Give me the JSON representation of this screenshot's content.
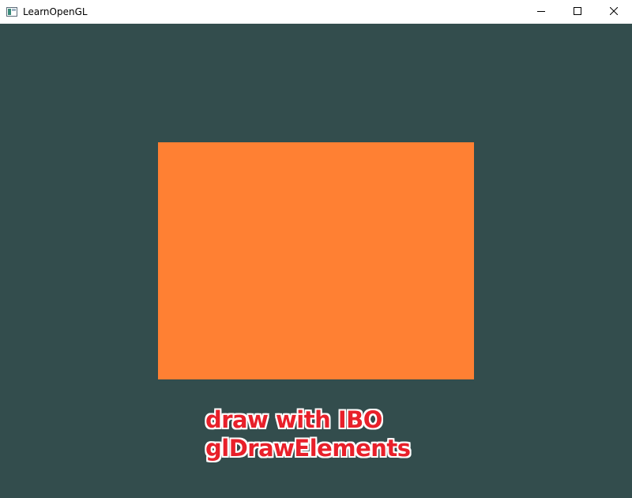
{
  "window": {
    "title": "LearnOpenGL",
    "icon": "app-window-icon",
    "controls": [
      "minimize-icon",
      "maximize-icon",
      "close-icon"
    ]
  },
  "scene": {
    "clear_color": "#334d4d",
    "quad_color": "#ff8033"
  },
  "annotation": {
    "line1": "draw with IBO",
    "line2": "glDrawElements",
    "color": "#e8202a"
  }
}
